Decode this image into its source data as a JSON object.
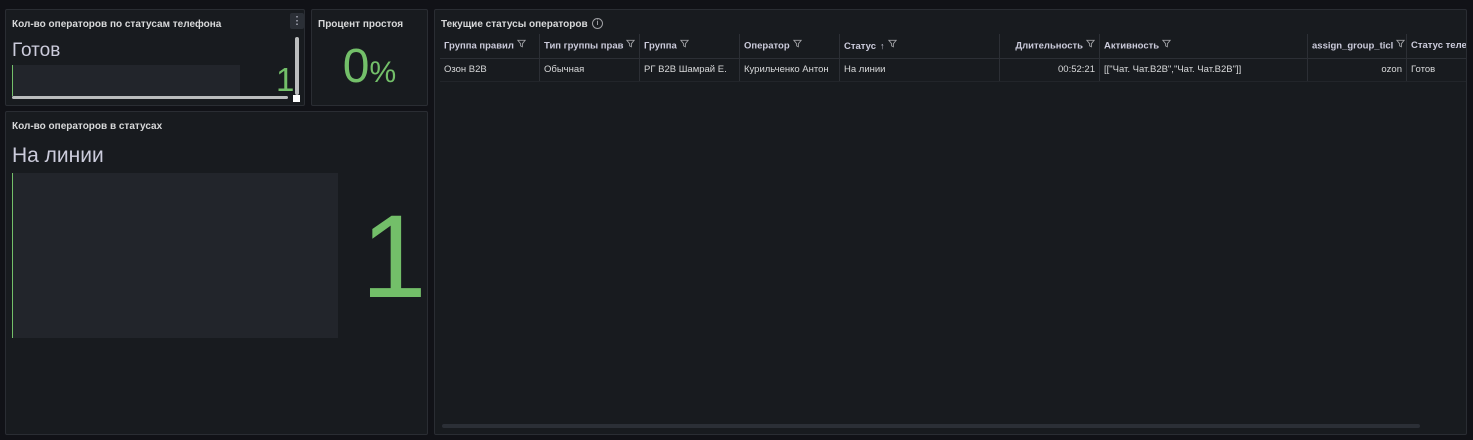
{
  "panel_phone_status": {
    "title": "Кол-во операторов по статусам телефона",
    "menu_icon": "⋮",
    "label": "Готов",
    "value": "1",
    "accent": "#73bf69"
  },
  "panel_idle": {
    "title": "Процент простоя",
    "value": "0",
    "unit": "%",
    "accent": "#73bf69"
  },
  "panel_status_count": {
    "title": "Кол-во операторов в статусах",
    "label": "На линии",
    "value": "1",
    "accent": "#73bf69"
  },
  "panel_current": {
    "title": "Текущие статусы операторов",
    "info_icon": "i",
    "columns": [
      {
        "label": "Группа правил",
        "filter": true
      },
      {
        "label": "Тип группы прав",
        "filter": true
      },
      {
        "label": "Группа",
        "filter": true
      },
      {
        "label": "Оператор",
        "filter": true
      },
      {
        "label": "Статус",
        "filter": true,
        "sort": "↑"
      },
      {
        "label": "Длительность",
        "filter": true
      },
      {
        "label": "Активность",
        "filter": true
      },
      {
        "label": "assign_group_ticl",
        "filter": true
      },
      {
        "label": "Статус теле",
        "filter": false
      }
    ],
    "rows": [
      [
        "Озон B2B",
        "Обычная",
        "РГ B2B Шамрай Е.",
        "Курильченко Антон",
        "На линии",
        "00:52:21",
        "[[\"Чат. Чат.B2B\",\"Чат. Чат.B2B\"]]",
        "ozon",
        "Готов"
      ]
    ]
  }
}
